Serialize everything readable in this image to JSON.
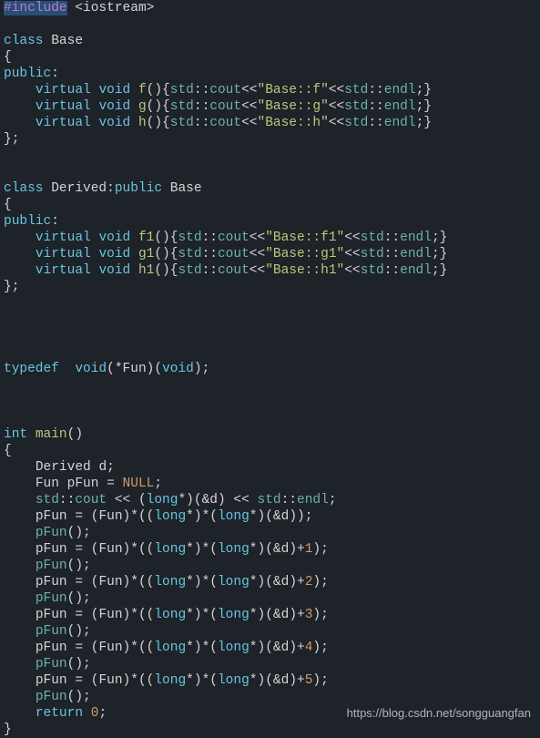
{
  "code": {
    "include": "#include",
    "iostream": "<iostream>",
    "class": "class",
    "Base": "Base",
    "Derived": "Derived",
    "public": "public",
    "virtual": "virtual",
    "void": "void",
    "typedef": "typedef",
    "int": "int",
    "long": "long",
    "return": "return",
    "main": "main",
    "std": "std",
    "cout": "cout",
    "endl": "endl",
    "NULL": "NULL",
    "pFun": "pFun",
    "Fun": "Fun",
    "d": "d",
    "f": "f",
    "g": "g",
    "h": "h",
    "f1": "f1",
    "g1": "g1",
    "h1": "h1",
    "str_f": "\"Base::f\"",
    "str_g": "\"Base::g\"",
    "str_h": "\"Base::h\"",
    "str_f1": "\"Base::f1\"",
    "str_g1": "\"Base::g1\"",
    "str_h1": "\"Base::h1\"",
    "n0": "0",
    "n1": "1",
    "n2": "2",
    "n3": "3",
    "n4": "4",
    "n5": "5"
  },
  "watermark": "https://blog.csdn.net/songguangfan"
}
